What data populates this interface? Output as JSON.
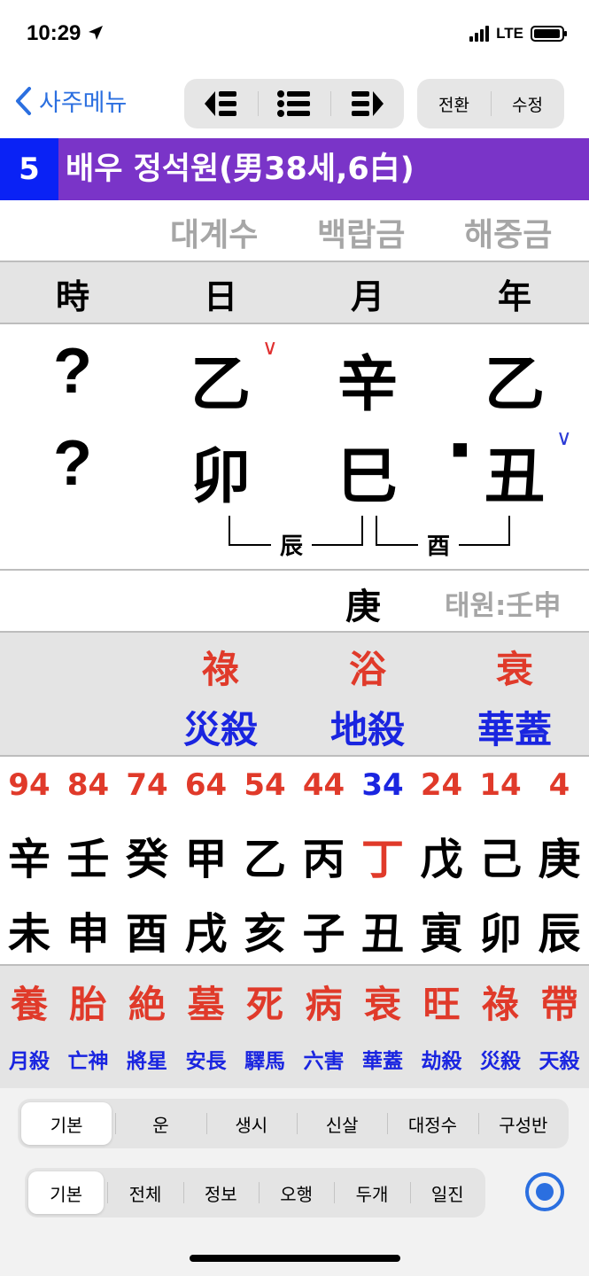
{
  "status": {
    "time": "10:29",
    "network": "LTE"
  },
  "nav": {
    "back_label": "사주메뉴",
    "switch_label": "전환",
    "edit_label": "수정"
  },
  "title": {
    "number": "5",
    "text": "배우 정석원(男38세,6白)"
  },
  "napeum": [
    "대계수",
    "백랍금",
    "해중금"
  ],
  "headers": {
    "hour": "時",
    "day": "日",
    "month": "月",
    "year": "年"
  },
  "stems": {
    "hour": "?",
    "day": "乙",
    "month": "辛",
    "year": "乙"
  },
  "branches": {
    "hour": "?",
    "day": "卯",
    "month": "巳",
    "year": "丑"
  },
  "marks": {
    "check": "∨",
    "square": "■"
  },
  "hidden": {
    "first": "辰",
    "second": "酉"
  },
  "extra": {
    "stem": "庚",
    "taewon": "태원:壬申"
  },
  "stages": {
    "day": "祿",
    "month": "浴",
    "year": "衰"
  },
  "spirits": {
    "day": "災殺",
    "month": "地殺",
    "year": "華蓋"
  },
  "luck": {
    "ages": [
      "94",
      "84",
      "74",
      "64",
      "54",
      "44",
      "34",
      "24",
      "14",
      "4"
    ],
    "current_index": 6,
    "stems": [
      "辛",
      "壬",
      "癸",
      "甲",
      "乙",
      "丙",
      "丁",
      "戊",
      "己",
      "庚"
    ],
    "branches": [
      "未",
      "申",
      "酉",
      "戌",
      "亥",
      "子",
      "丑",
      "寅",
      "卯",
      "辰"
    ],
    "stages": [
      "養",
      "胎",
      "絶",
      "墓",
      "死",
      "病",
      "衰",
      "旺",
      "祿",
      "帶"
    ],
    "spirits": [
      "月殺",
      "亡神",
      "將星",
      "安長",
      "驛馬",
      "六害",
      "華蓋",
      "劫殺",
      "災殺",
      "天殺"
    ]
  },
  "tabs_top": [
    "기본",
    "운",
    "생시",
    "신살",
    "대정수",
    "구성반"
  ],
  "tabs_bottom": [
    "기본",
    "전체",
    "정보",
    "오행",
    "두개",
    "일진"
  ],
  "colors": {
    "title_bg": "#7a34c8",
    "number_bg": "#0a22f5",
    "red": "#e03a2a",
    "blue": "#1a25e0",
    "accent": "#2b6fe0"
  }
}
